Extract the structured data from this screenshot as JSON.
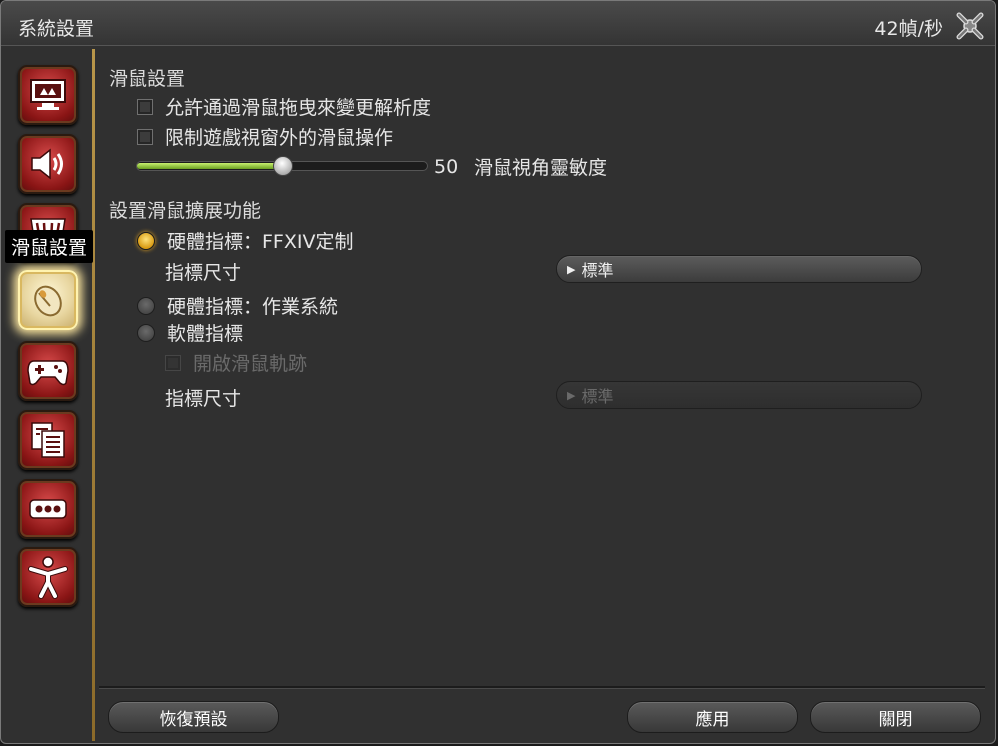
{
  "window": {
    "title": "系統設置",
    "fps": "42幀/秒"
  },
  "sidebar": {
    "tooltip": "滑鼠設置",
    "items": [
      {
        "icon": "display-icon"
      },
      {
        "icon": "speaker-icon"
      },
      {
        "icon": "theater-icon"
      },
      {
        "icon": "mouse-icon",
        "selected": true
      },
      {
        "icon": "gamepad-icon"
      },
      {
        "icon": "documents-icon"
      },
      {
        "icon": "ellipsis-icon"
      },
      {
        "icon": "accessibility-icon"
      }
    ]
  },
  "mouse": {
    "section_title": "滑鼠設置",
    "allow_resize_label": "允許通過滑鼠拖曳來變更解析度",
    "restrict_label": "限制遊戲視窗外的滑鼠操作",
    "sensitivity_value": "50",
    "sensitivity_label": "滑鼠視角靈敏度",
    "sensitivity_fraction": 0.5
  },
  "extended": {
    "section_title": "設置滑鼠擴展功能",
    "hw_custom_label": "硬體指標：FFXIV定制",
    "size_label_1": "指標尺寸",
    "size_value_1": "標準",
    "hw_os_label": "硬體指標：作業系統",
    "sw_label": "軟體指標",
    "trail_label": "開啟滑鼠軌跡",
    "size_label_2": "指標尺寸",
    "size_value_2": "標準"
  },
  "footer": {
    "reset": "恢復預設",
    "apply": "應用",
    "close": "關閉"
  },
  "colors": {
    "accent_gold": "#c8a050",
    "category_red": "#b32020",
    "slider_green": "#8cc83c"
  }
}
